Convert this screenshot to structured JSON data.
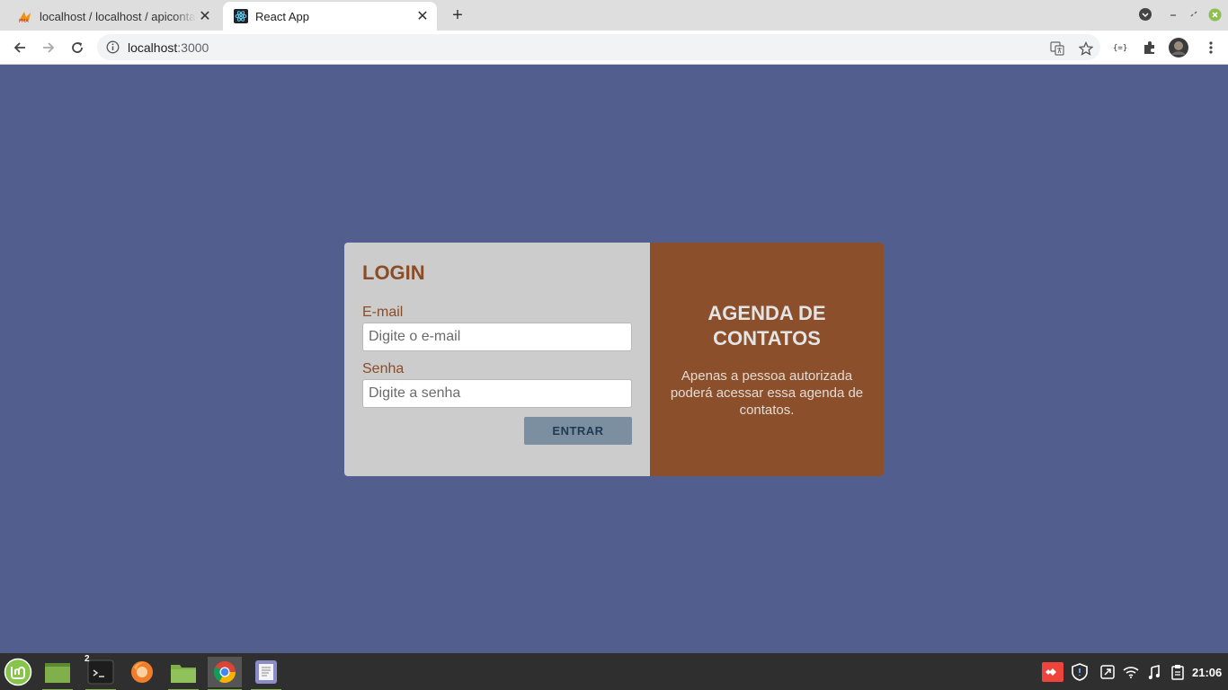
{
  "browser": {
    "tabs": [
      {
        "title": "localhost / localhost / apicontatos",
        "active": false
      },
      {
        "title": "React App",
        "active": true
      }
    ],
    "new_tab_label": "+",
    "address": {
      "host": "localhost",
      "port": ":3000"
    }
  },
  "login": {
    "title": "LOGIN",
    "email_label": "E-mail",
    "email_placeholder": "Digite o e-mail",
    "email_value": "",
    "password_label": "Senha",
    "password_placeholder": "Digite a senha",
    "password_value": "",
    "submit_label": "ENTRAR"
  },
  "info": {
    "title": "AGENDA DE CONTATOS",
    "text": "Apenas a pessoa autorizada poderá acessar essa agenda de contatos."
  },
  "taskbar": {
    "apps": [
      "menu-icon",
      "show-desktop-icon",
      "terminal-icon",
      "firefox-icon",
      "files-icon",
      "chrome-icon",
      "text-editor-icon"
    ],
    "terminal_badge": "2",
    "clock": "21:06"
  },
  "colors": {
    "page_background": "#525f8e",
    "login_panel": "#cccccc",
    "info_panel": "#8b4f2b",
    "accent_text": "#8b4c28",
    "button": "#7b8fa1"
  }
}
